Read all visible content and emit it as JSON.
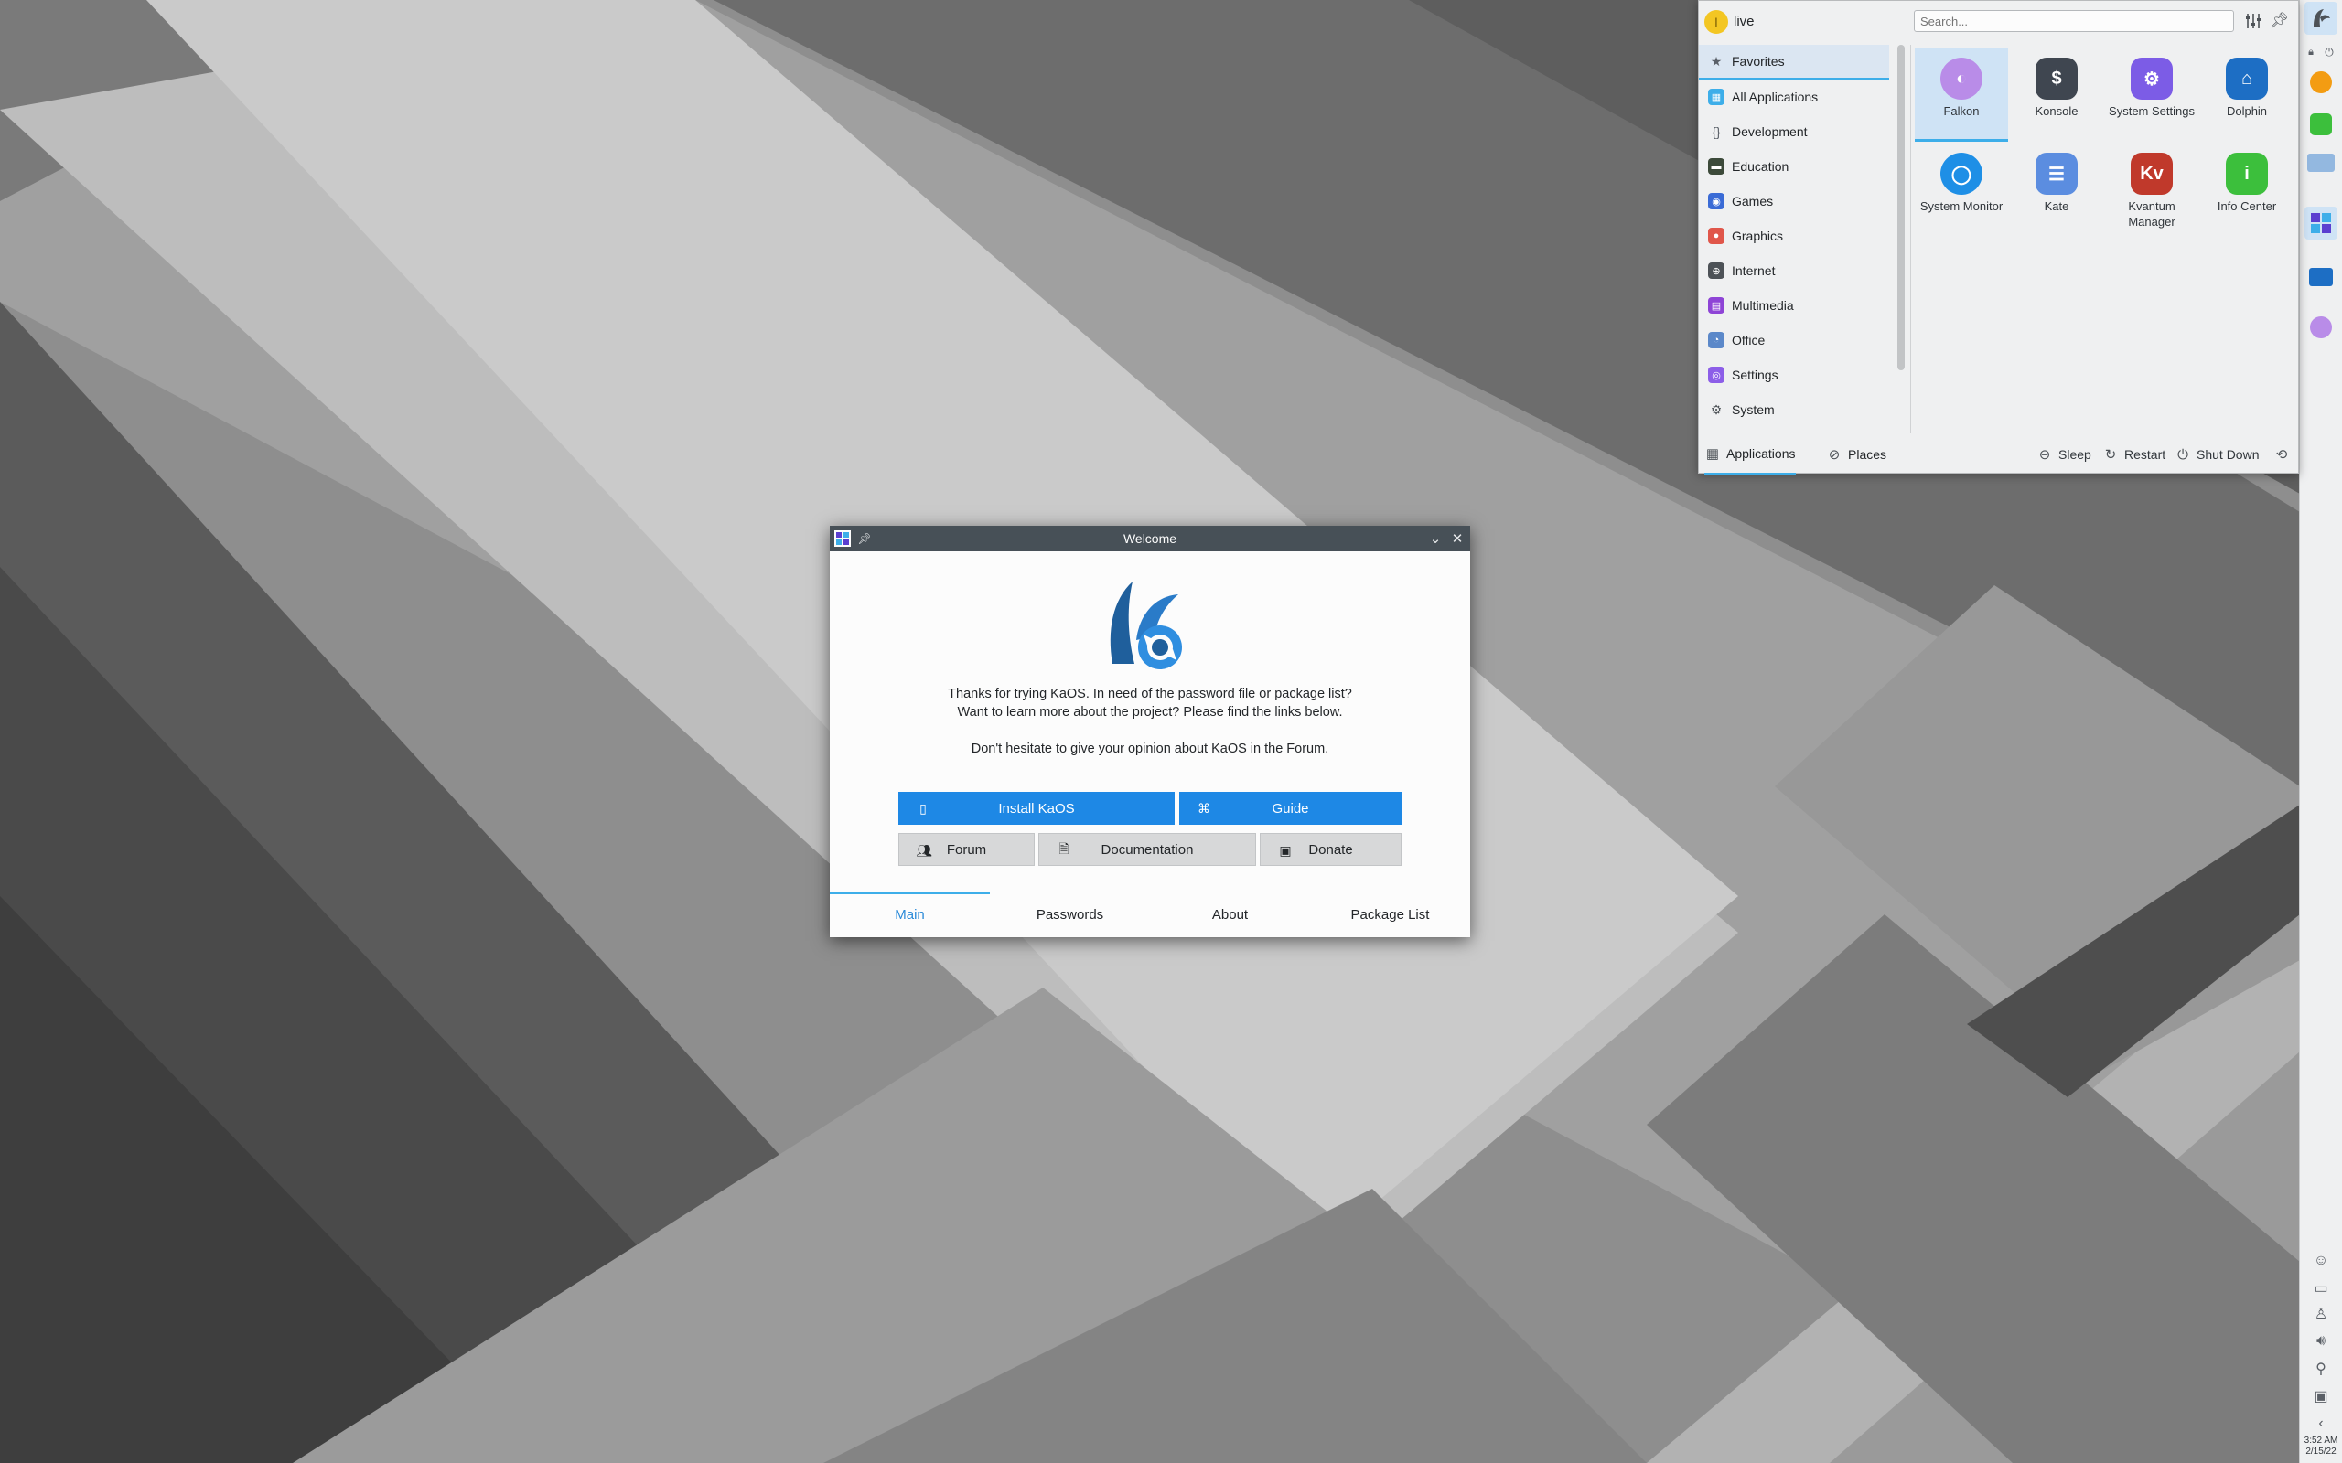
{
  "launcher": {
    "username": "live",
    "avatar_letter": "l",
    "search_placeholder": "Search...",
    "categories": [
      {
        "label": "Favorites",
        "icon": "star-icon",
        "color": "#5a6068"
      },
      {
        "label": "All Applications",
        "icon": "grid-icon",
        "color": "#3daee9"
      },
      {
        "label": "Development",
        "icon": "braces-icon",
        "color": "#5a6068"
      },
      {
        "label": "Education",
        "icon": "chalkboard-icon",
        "color": "#3c4a3a"
      },
      {
        "label": "Games",
        "icon": "gamepad-icon",
        "color": "#3a6bd6"
      },
      {
        "label": "Graphics",
        "icon": "color-wheel-icon",
        "color": "#e0564a"
      },
      {
        "label": "Internet",
        "icon": "globe-icon",
        "color": "#4d5257"
      },
      {
        "label": "Multimedia",
        "icon": "media-icon",
        "color": "#8e44d6"
      },
      {
        "label": "Office",
        "icon": "office-icon",
        "color": "#5b88c9"
      },
      {
        "label": "Settings",
        "icon": "settings-icon",
        "color": "#8c5ee8"
      },
      {
        "label": "System",
        "icon": "gear-icon",
        "color": "#4d5257"
      }
    ],
    "apps": [
      {
        "name": "Falkon",
        "icon": "falkon-icon",
        "color": "#b98ce8",
        "glyph": "◐"
      },
      {
        "name": "Konsole",
        "icon": "konsole-icon",
        "color": "#3f4650",
        "glyph": "$"
      },
      {
        "name": "System Settings",
        "icon": "system-settings-icon",
        "color": "#7c5ce6",
        "glyph": "⚙"
      },
      {
        "name": "Dolphin",
        "icon": "dolphin-icon",
        "color": "#1d6ec4",
        "glyph": "⌂"
      },
      {
        "name": "System Monitor",
        "icon": "system-monitor-icon",
        "color": "#1e8fe6",
        "glyph": "◯"
      },
      {
        "name": "Kate",
        "icon": "kate-icon",
        "color": "#5b8de0",
        "glyph": "☰"
      },
      {
        "name": "Kvantum Manager",
        "icon": "kvantum-icon",
        "color": "#c0392b",
        "glyph": "Kv"
      },
      {
        "name": "Info Center",
        "icon": "info-center-icon",
        "color": "#3cbf3c",
        "glyph": "i"
      }
    ],
    "footer": {
      "applications": "Applications",
      "places": "Places",
      "sleep": "Sleep",
      "restart": "Restart",
      "shutdown": "Shut Down"
    }
  },
  "welcome": {
    "title": "Welcome",
    "text_line1": "Thanks for trying KaOS. In need of the password file or package list?",
    "text_line2": "Want to learn more about the project? Please find the links below.",
    "text_line3": "Don't hesitate to give your opinion about KaOS in the Forum.",
    "buttons": {
      "install": "Install KaOS",
      "guide": "Guide",
      "forum": "Forum",
      "documentation": "Documentation",
      "donate": "Donate"
    },
    "tabs": [
      "Main",
      "Passwords",
      "About",
      "Package List"
    ],
    "active_tab": "Main"
  },
  "clock": {
    "time": "3:52 AM",
    "date": "2/15/22"
  },
  "colors": {
    "accent": "#3daee9",
    "button_blue": "#1e88e5",
    "titlebar": "#475057"
  }
}
